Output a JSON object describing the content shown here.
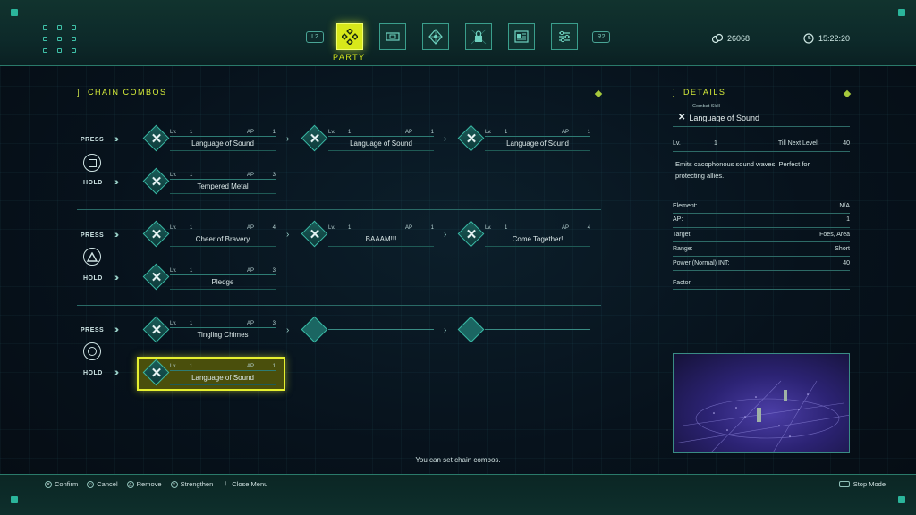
{
  "topbar": {
    "left_shoulder": "L2",
    "right_shoulder": "R2",
    "active_tab_label": "PARTY",
    "tabs": [
      "party-icon",
      "equipment-icon",
      "crystal-icon",
      "lock-icon",
      "datalog-icon",
      "settings-icon"
    ],
    "currency": "26068",
    "time": "15:22:20"
  },
  "chain_combos": {
    "title": "CHAIN COMBOS",
    "press_label": "PRESS",
    "hold_label": "HOLD",
    "groups": [
      {
        "button": "square",
        "press": [
          {
            "lv_label": "Lv.",
            "lv": "1",
            "ap_label": "AP",
            "ap": "1",
            "name": "Language of Sound"
          },
          {
            "lv_label": "Lv.",
            "lv": "1",
            "ap_label": "AP",
            "ap": "1",
            "name": "Language of Sound"
          },
          {
            "lv_label": "Lv.",
            "lv": "1",
            "ap_label": "AP",
            "ap": "1",
            "name": "Language of Sound"
          }
        ],
        "hold": {
          "lv_label": "Lv.",
          "lv": "1",
          "ap_label": "AP",
          "ap": "3",
          "name": "Tempered Metal"
        }
      },
      {
        "button": "triangle",
        "press": [
          {
            "lv_label": "Lv.",
            "lv": "1",
            "ap_label": "AP",
            "ap": "4",
            "name": "Cheer of Bravery"
          },
          {
            "lv_label": "Lv.",
            "lv": "1",
            "ap_label": "AP",
            "ap": "1",
            "name": "BAAAM!!!"
          },
          {
            "lv_label": "Lv.",
            "lv": "1",
            "ap_label": "AP",
            "ap": "4",
            "name": "Come Together!"
          }
        ],
        "hold": {
          "lv_label": "Lv.",
          "lv": "1",
          "ap_label": "AP",
          "ap": "3",
          "name": "Pledge"
        }
      },
      {
        "button": "circle",
        "press": [
          {
            "lv_label": "Lv.",
            "lv": "1",
            "ap_label": "AP",
            "ap": "3",
            "name": "Tingling Chimes"
          }
        ],
        "hold": {
          "lv_label": "Lv.",
          "lv": "1",
          "ap_label": "AP",
          "ap": "1",
          "name": "Language of Sound"
        }
      }
    ]
  },
  "details": {
    "title": "DETAILS",
    "category": "Combat Skill",
    "skill_name": "Language of Sound",
    "lv_label": "Lv.",
    "lv": "1",
    "next_label": "Till Next Level:",
    "next_value": "40",
    "description_line1": "Emits cacophonous sound waves. Perfect for",
    "description_line2": "protecting allies.",
    "stats": [
      {
        "key": "Element:",
        "value": "N/A"
      },
      {
        "key": "AP:",
        "value": "1"
      },
      {
        "key": "Target:",
        "value": "Foes, Area"
      },
      {
        "key": "Range:",
        "value": "Short"
      },
      {
        "key": "Power (Normal) INT:",
        "value": "40"
      },
      {
        "key": "Factor",
        "value": ""
      }
    ]
  },
  "footer": {
    "hint": "You can set chain combos.",
    "controls": [
      {
        "icon": "✕",
        "label": "Confirm"
      },
      {
        "icon": "○",
        "label": "Cancel"
      },
      {
        "icon": "△",
        "label": "Remove"
      },
      {
        "icon": "□",
        "label": "Strengthen"
      },
      {
        "icon": "❘",
        "label": "Close Menu"
      }
    ],
    "stop_mode": "Stop Mode"
  }
}
